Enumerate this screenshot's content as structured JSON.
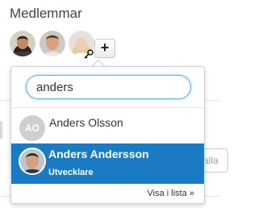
{
  "section": {
    "title": "Medlemmar"
  },
  "members": [
    {
      "name": "member-avatar-1"
    },
    {
      "name": "member-avatar-2"
    },
    {
      "name": "member-avatar-3"
    }
  ],
  "icons": {
    "add": "plus-icon",
    "key": "key-icon"
  },
  "add_button": {
    "label": "+"
  },
  "background": {
    "field_fragment": "alla"
  },
  "dropdown": {
    "search": {
      "value": "anders",
      "placeholder": ""
    },
    "results": [
      {
        "initials": "AO",
        "name": "Anders Olsson",
        "role": ""
      },
      {
        "name": "Anders Andersson",
        "role": "Utvecklare"
      }
    ],
    "show_in_list": "Visa i lista »"
  },
  "colors": {
    "accent_blue": "#1a7bc4",
    "focus_ring": "#66afe9",
    "initials_bg": "#cfcfcf"
  }
}
